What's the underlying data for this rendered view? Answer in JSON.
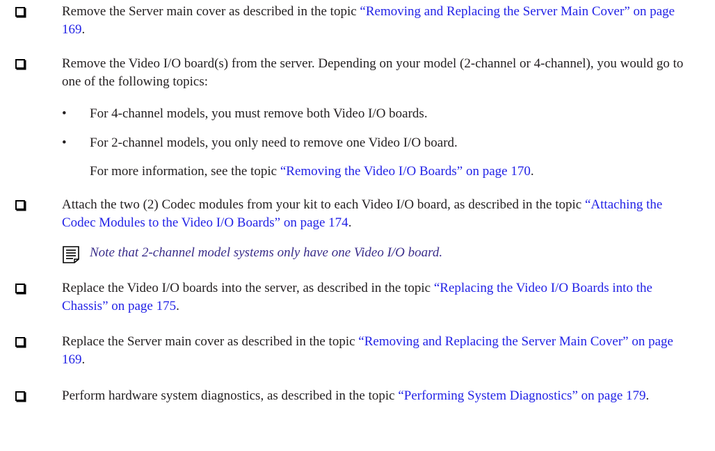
{
  "steps": [
    {
      "text": "Remove the Server main cover as described in the topic ",
      "link": "“Removing and Replacing the Server Main Cover” on page 169",
      "end": "."
    },
    {
      "text": "Remove the Video I/O board(s) from the server. Depending on your model (2-channel or 4-channel), you would go to one of the following topics:",
      "bullets": [
        "For 4-channel models, you must remove both Video I/O boards.",
        "For 2-channel models, you only need to remove one Video I/O board."
      ],
      "more_info": {
        "text": "For more information, see the topic ",
        "link": "“Removing the Video I/O Boards” on page 170",
        "end": "."
      }
    },
    {
      "text": "Attach the two (2) Codec modules from your kit to each Video I/O board, as described in the topic ",
      "link": "“Attaching the Codec Modules to the Video I/O Boards” on page 174",
      "end": ".",
      "note": "Note that 2-channel model systems only have one Video I/O board."
    },
    {
      "text": "Replace the Video I/O boards into the server, as described in the topic ",
      "link": "“Replacing the Video I/O Boards into the Chassis” on page 175",
      "end": "."
    },
    {
      "text": "Replace the Server main cover as described in the topic ",
      "link": "“Removing and Replacing the Server Main Cover” on page 169",
      "end": "."
    },
    {
      "text": "Perform hardware system diagnostics, as described in the topic ",
      "link": "“Performing System Diagnostics” on page 179",
      "end": "."
    }
  ],
  "bullet_glyph": "•",
  "note_icon": "note-icon",
  "colors": {
    "link": "#2323e6",
    "note_text": "#3a2d8a",
    "body_text": "#231f20"
  }
}
